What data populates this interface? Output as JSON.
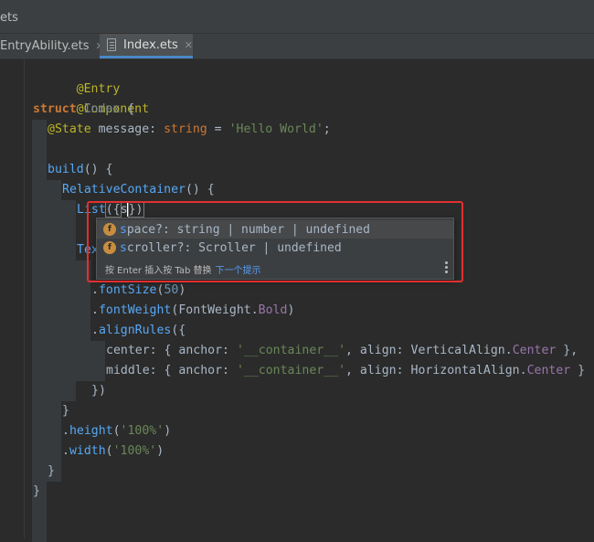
{
  "window": {
    "title": "ets"
  },
  "tabs": [
    {
      "label": "EntryAbility.ets",
      "close": "✕"
    },
    {
      "label": "Index.ets",
      "close": "✕"
    }
  ],
  "code": {
    "l1": "@Entry",
    "l2": "@Component",
    "l3": {
      "kw": "struct",
      "name": "Index",
      "brace": "{"
    },
    "l4": {
      "ann": "@State",
      "name": "message",
      "colon": ":",
      "type": "string",
      "eq": "=",
      "value": "'Hello World'",
      "end": ";"
    },
    "l5": {
      "fn": "build",
      "rest": "() {"
    },
    "l6": {
      "fn": "RelativeContainer",
      "rest": "() {"
    },
    "l7": {
      "fn": "List",
      "open": "({",
      "typed": "s",
      "close": "})"
    },
    "l8": {
      "partial": "Tex"
    },
    "l9": {
      "dot": ".",
      "fn": "fontSize",
      "open": "(",
      "num": "50",
      "close": ")"
    },
    "l10": {
      "dot": ".",
      "fn": "fontWeight",
      "open": "(",
      "arg": "FontWeight",
      "dot2": ".",
      "val": "Bold",
      "close": ")"
    },
    "l11": {
      "dot": ".",
      "fn": "alignRules",
      "open": "({"
    },
    "l12": {
      "key": "center",
      "p1": ": { ",
      "k1": "anchor",
      "c1": ": ",
      "s1": "'__container__'",
      "p2": ", ",
      "k2": "align",
      "c2": ": ",
      "e1": "VerticalAlign",
      "d": ".",
      "e2": "Center",
      "end": " },"
    },
    "l13": {
      "key": "middle",
      "p1": ": { ",
      "k1": "anchor",
      "c1": ": ",
      "s1": "'__container__'",
      "p2": ", ",
      "k2": "align",
      "c2": ": ",
      "e1": "HorizontalAlign",
      "d": ".",
      "e2": "Center",
      "end": " }"
    },
    "l14": "})",
    "l15": "}",
    "l16": {
      "dot": ".",
      "fn": "height",
      "open": "(",
      "str": "'100%'",
      "close": ")"
    },
    "l17": {
      "dot": ".",
      "fn": "width",
      "open": "(",
      "str": "'100%'",
      "close": ")"
    },
    "l18": "}",
    "l19": "}"
  },
  "completion": {
    "items": [
      {
        "icon": "f",
        "match": "s",
        "name": "pace?",
        "detail": ": string | number | undefined"
      },
      {
        "icon": "f",
        "match": "s",
        "name": "croller?",
        "detail": ": Scroller | undefined"
      }
    ],
    "hint": "按 Enter 插入按 Tab 替换",
    "next_hint": "下一个提示"
  }
}
